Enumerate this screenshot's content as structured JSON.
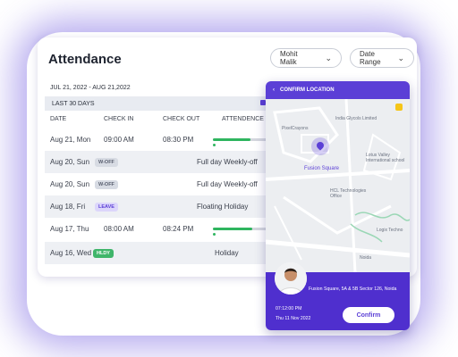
{
  "page": {
    "title": "Attendance"
  },
  "filters": {
    "employee": "Mohit Malik",
    "range_label": "Date Range"
  },
  "date_range": "JUL 21, 2022 - AUG 21,2022",
  "period_label": "LAST 30 DAYS",
  "columns": [
    "DATE",
    "CHECK IN",
    "CHECK OUT",
    "ATTENDENCE V"
  ],
  "rows": [
    {
      "date": "Aug 21, Mon",
      "check_in": "09:00 AM",
      "check_out": "08:30 PM",
      "badge": "",
      "note": "",
      "progress": 0.65
    },
    {
      "date": "Aug 20, Sun",
      "check_in": "",
      "check_out": "",
      "badge": "W-OFF",
      "note": "Full day Weekly-off",
      "progress": null
    },
    {
      "date": "Aug 20, Sun",
      "check_in": "",
      "check_out": "",
      "badge": "W-OFF",
      "note": "Full day Weekly-off",
      "progress": null
    },
    {
      "date": "Aug 18, Fri",
      "check_in": "",
      "check_out": "",
      "badge": "LEAVE",
      "note": "Floating Holiday",
      "progress": null
    },
    {
      "date": "Aug 17, Thu",
      "check_in": "08:00 AM",
      "check_out": "08:24 PM",
      "badge": "",
      "note": "",
      "progress": 0.68
    },
    {
      "date": "Aug 16, Wed",
      "check_in": "",
      "check_out": "",
      "badge": "HLDY",
      "note": "Holiday",
      "progress": null
    }
  ],
  "confirm_panel": {
    "header": "CONFIRM LOCATION",
    "map_labels": {
      "india_glycols": "India Glycols Limited",
      "pixelcrayons": "PixelCrayons",
      "fusion_square": "Fusion Square",
      "lotus_valley": "Lotus Valley International school",
      "hcl": "HCL Technologies Office",
      "logix": "Logix Techno",
      "noida": "Noida"
    },
    "location": "Fusion Square, 5A & 5B Sector 126, Noida",
    "time": "07:12:00 PM",
    "date": "Thu 11 Nov 2022",
    "button": "Confirm"
  },
  "colors": {
    "accent": "#5b3fd6",
    "success": "#2fb55f"
  }
}
